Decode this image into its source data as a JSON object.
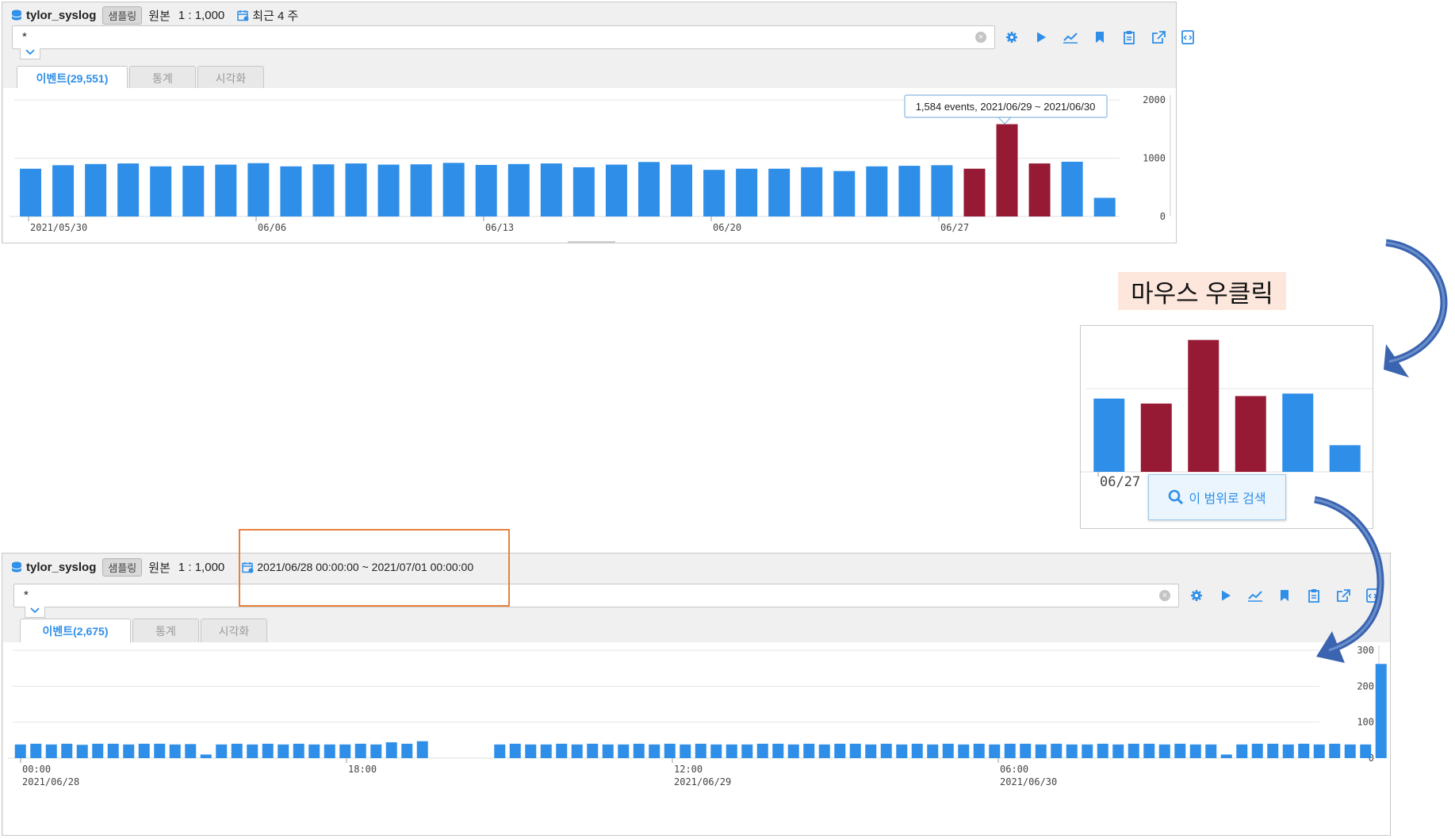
{
  "top_panel": {
    "db_name": "tylor_syslog",
    "sampling_label": "샘플링",
    "source_label": "원본",
    "ratio": "1 : 1,000",
    "range_label": "최근 4 주",
    "query": "*",
    "tabs": [
      {
        "label": "이벤트(29,551)",
        "active": true
      },
      {
        "label": "통계",
        "active": false
      },
      {
        "label": "시각화",
        "active": false
      }
    ],
    "tooltip": "1,584 events, 2021/06/29 ~ 2021/06/30"
  },
  "callout_label": "마우스 우클릭",
  "context_menu": {
    "search_range_label": "이 범위로 검색"
  },
  "zoom_inset": {
    "x_label": "06/27"
  },
  "bottom_panel": {
    "db_name": "tylor_syslog",
    "sampling_label": "샘플링",
    "source_label": "원본",
    "ratio": "1 : 1,000",
    "range_label": "2021/06/28 00:00:00 ~ 2021/07/01 00:00:00",
    "query": "*",
    "tabs": [
      {
        "label": "이벤트(2,675)",
        "active": true
      },
      {
        "label": "통계",
        "active": false
      },
      {
        "label": "시각화",
        "active": false
      }
    ]
  },
  "colors": {
    "bar": "#2f8fe8",
    "selected_bar": "#961a33",
    "accent": "#2f8fe8",
    "arrow": "#3a64b0",
    "highlight_box": "#e8813e",
    "callout_bg": "#fde7dd"
  },
  "toolbar_icons": [
    "gear-icon",
    "play-icon",
    "line-chart-icon",
    "bookmark-icon",
    "clipboard-icon",
    "export-icon",
    "code-icon"
  ],
  "chart_data": [
    {
      "type": "bar",
      "x_labels": [
        "2021/05/30",
        "06/06",
        "06/13",
        "06/20",
        "06/27"
      ],
      "values": [
        820,
        880,
        900,
        910,
        860,
        870,
        890,
        915,
        860,
        895,
        910,
        890,
        895,
        920,
        885,
        900,
        910,
        845,
        890,
        935,
        890,
        800,
        820,
        820,
        845,
        780,
        860,
        870,
        880,
        820,
        1584,
        910,
        940,
        320
      ],
      "selected_indices": [
        29,
        30,
        31
      ],
      "yticks": [
        0,
        1000,
        2000
      ],
      "ylim": [
        0,
        2000
      ],
      "grid": true
    },
    {
      "type": "bar",
      "x_labels": [
        "06/27"
      ],
      "values": [
        880,
        820,
        1584,
        910,
        940,
        320
      ],
      "selected_indices": [
        1,
        2,
        3
      ],
      "ylim": [
        0,
        2000
      ],
      "grid": true
    },
    {
      "type": "bar",
      "x_labels": [
        "00:00\n2021/06/28",
        "18:00",
        "12:00\n2021/06/29",
        "06:00\n2021/06/30"
      ],
      "values": [
        38,
        40,
        38,
        40,
        37,
        40,
        40,
        38,
        40,
        40,
        38,
        39,
        10,
        38,
        40,
        38,
        40,
        38,
        40,
        38,
        38,
        38,
        40,
        38,
        44,
        40,
        47,
        0,
        0,
        0,
        0,
        38,
        40,
        38,
        38,
        40,
        38,
        40,
        38,
        38,
        40,
        38,
        40,
        38,
        40,
        38,
        38,
        38,
        40,
        40,
        38,
        40,
        38,
        40,
        40,
        38,
        40,
        38,
        40,
        38,
        40,
        38,
        40,
        38,
        40,
        40,
        38,
        40,
        38,
        38,
        40,
        38,
        40,
        40,
        38,
        40,
        38,
        38,
        10,
        38,
        40,
        40,
        38,
        40,
        38,
        40,
        38,
        38,
        262
      ],
      "yticks": [
        0,
        100,
        200,
        300
      ],
      "ylim": [
        0,
        300
      ],
      "grid": true
    }
  ]
}
